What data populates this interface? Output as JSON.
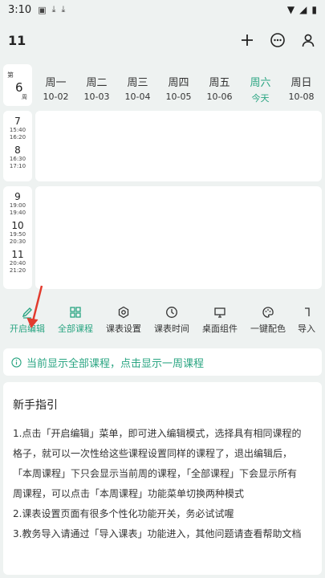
{
  "statusbar": {
    "time": "3:10"
  },
  "appbar": {
    "title": "11"
  },
  "week": {
    "prefix": "第",
    "number": "6",
    "suffix": "周"
  },
  "days": [
    {
      "name": "周一",
      "date": "10-02"
    },
    {
      "name": "周二",
      "date": "10-03"
    },
    {
      "name": "周三",
      "date": "10-04"
    },
    {
      "name": "周四",
      "date": "10-05"
    },
    {
      "name": "周五",
      "date": "10-06"
    },
    {
      "name": "周六",
      "date": "今天"
    },
    {
      "name": "周日",
      "date": "10-08"
    }
  ],
  "slots_top": [
    {
      "n": "7",
      "start": "15:40",
      "end": "16:20"
    },
    {
      "n": "8",
      "start": "16:30",
      "end": "17:10"
    }
  ],
  "slots_bottom": [
    {
      "n": "9",
      "start": "19:00",
      "end": "19:40"
    },
    {
      "n": "10",
      "start": "19:50",
      "end": "20:30"
    },
    {
      "n": "11",
      "start": "20:40",
      "end": "21:20"
    }
  ],
  "toolbar": [
    {
      "label": "开启编辑",
      "icon": "pencil-icon"
    },
    {
      "label": "全部课程",
      "icon": "grid-icon"
    },
    {
      "label": "课表设置",
      "icon": "gear-icon"
    },
    {
      "label": "课表时间",
      "icon": "clock-icon"
    },
    {
      "label": "桌面组件",
      "icon": "monitor-icon"
    },
    {
      "label": "一键配色",
      "icon": "palette-icon"
    },
    {
      "label": "导入",
      "icon": "import-icon"
    }
  ],
  "notice": "当前显示全部课程，点击显示一周课程",
  "guide": {
    "title": "新手指引",
    "lines": [
      "1.点击「开启编辑」菜单，即可进入编辑模式，选择具有相同课程的",
      "格子，就可以一次性给这些课程设置同样的课程了，退出编辑后，",
      "「本周课程」下只会显示当前周的课程，「全部课程」下会显示所有",
      "周课程，可以点击「本周课程」功能菜单切换两种模式",
      "2.课表设置页面有很多个性化功能开关，务必试试喔",
      "3.教务导入请通过「导入课表」功能进入，其他问题请查看帮助文档"
    ]
  },
  "colors": {
    "accent": "#2aa582",
    "arrow": "#e23b2e"
  }
}
